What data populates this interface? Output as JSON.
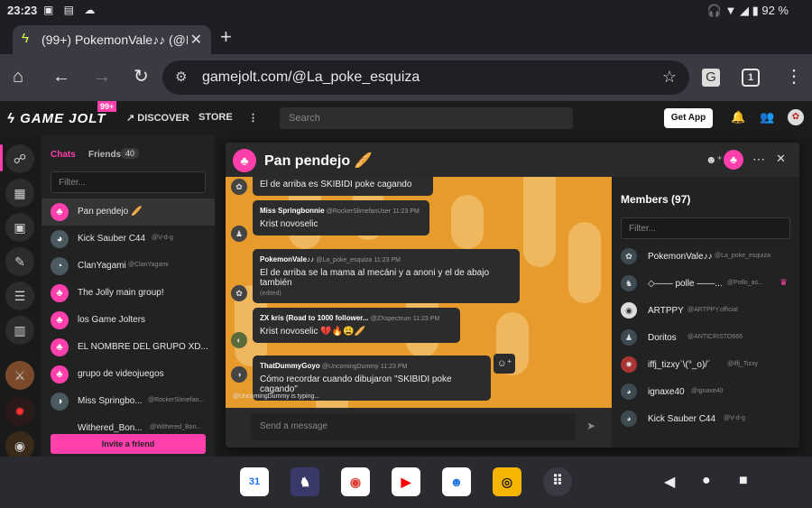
{
  "status_bar": {
    "time": "23:23",
    "battery": "92 %"
  },
  "browser": {
    "tab_title": "(99+) PokemonVale♪♪ (@La_p",
    "url": "gamejolt.com/@La_poke_esquiza",
    "tab_count": "1"
  },
  "gamejolt": {
    "logo": "GAME JOLT",
    "badge": "99+",
    "nav": {
      "discover": "DISCOVER",
      "store": "STORE"
    },
    "search_placeholder": "Search",
    "get_app": "Get App"
  },
  "chats_panel": {
    "chats_tab": "Chats",
    "friends_tab": "Friends",
    "friends_count": "40",
    "filter_placeholder": "Filter...",
    "items": [
      {
        "name": "Pan pendejo 🥖",
        "handle": ""
      },
      {
        "name": "Kick Sauber C44",
        "handle": "@V-d-g"
      },
      {
        "name": "ClanYagami",
        "handle": "@ClanYagami"
      },
      {
        "name": "The Jolly main group!",
        "handle": ""
      },
      {
        "name": "los Game Jolters",
        "handle": ""
      },
      {
        "name": "EL NOMBRE DEL GRUPO XD...",
        "handle": ""
      },
      {
        "name": "grupo de videojuegos",
        "handle": ""
      },
      {
        "name": "Miss Springbo...",
        "handle": "@RockerSlimefan..."
      },
      {
        "name": "Withered_Bon...",
        "handle": "@Withered_Bon..."
      }
    ],
    "invite_label": "Invite a friend"
  },
  "chat_window": {
    "room_title": "Pan pendejo 🥖",
    "messages": [
      {
        "author": "",
        "handle": "",
        "time": "",
        "body": "El de arriba es SKIBIDI poke cagando",
        "edited": ""
      },
      {
        "author": "Miss Springbonnie",
        "handle": "@RockerSlimefanUser",
        "time": "11:23 PM",
        "body": "Krist novoselic",
        "edited": ""
      },
      {
        "author": "PokemonVale♪♪",
        "handle": "@La_poke_esquiza",
        "time": "11:23 PM",
        "body": "El de arriba se la mama al mecáni y a anoni y el de abajo también",
        "edited": "(edited)"
      },
      {
        "author": "ZX kris (Road to 1000 follower...",
        "handle": "@ZXspectrum",
        "time": "11:23 PM",
        "body": "Krist novoselic 💔🔥😩🥖",
        "edited": ""
      },
      {
        "author": "ThatDummyGoyo",
        "handle": "@UncomingDummy",
        "time": "11:23 PM",
        "body": "Cómo recordar cuando dibujaron \"SKIBIDI poke cagando\"",
        "edited": ""
      }
    ],
    "typing": "@UncomingDummy is typing...",
    "composer_placeholder": "Send a message",
    "members": {
      "title": "Members (97)",
      "filter_placeholder": "Filter...",
      "items": [
        {
          "name": "PokemonVale♪♪",
          "handle": "@La_poke_esquiza"
        },
        {
          "name": "◇—— polle ——...",
          "handle": "@Pollo_as..."
        },
        {
          "name": "ARTPPY",
          "handle": "@ARTPPY.official"
        },
        {
          "name": "Doritos",
          "handle": "@ANTICRISTO666"
        },
        {
          "name": "iffj_tizxy`\\(°_o)/´",
          "handle": "@iffj_Tizxy"
        },
        {
          "name": "ignaxe40",
          "handle": "@ignaxe40"
        },
        {
          "name": "Kick Sauber C44",
          "handle": "@V-d-g"
        }
      ]
    }
  },
  "colors": {
    "accent": "#ff3fac",
    "chat_bg": "#e79b2d"
  }
}
